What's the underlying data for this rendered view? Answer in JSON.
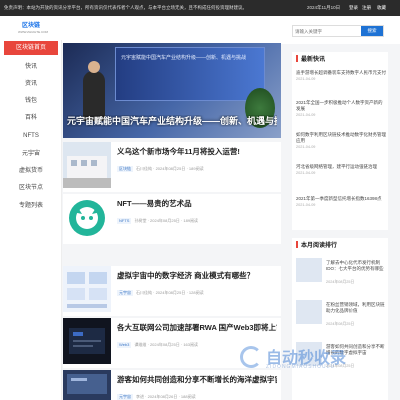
{
  "topbar": {
    "notice": "免责声明：本站为开放的资讯分享平台，所有资讯仅代表作者个人观点，与本平台立场无关，且不构成任何投资理财建议。",
    "date": "2024年11月10日",
    "login": "登录",
    "register": "注册",
    "favorite": "收藏"
  },
  "logo": {
    "name": "区块链",
    "sub": "WWW.ZHUIHTE.COM"
  },
  "sidebar": {
    "items": [
      {
        "label": "区块链首页",
        "active": true
      },
      {
        "label": "快讯"
      },
      {
        "label": "资讯"
      },
      {
        "label": "钱包"
      },
      {
        "label": "百科"
      },
      {
        "label": "NFTS"
      },
      {
        "label": "元宇宙"
      },
      {
        "label": "虚拟货币"
      },
      {
        "label": "区块节点"
      },
      {
        "label": "专题列表"
      }
    ]
  },
  "hero": {
    "screen_text": "元宇宙赋能中国汽车产业结构升级——创新、机遇与挑战",
    "caption": "元宇宙赋能中国汽车产业结构升级——创新、机遇与挑战”主题论"
  },
  "articles": [
    {
      "title": "义乌这个新市场今年11月将投入运营!",
      "tag": "区块链",
      "author": "石川佳纯",
      "date": "2024年08月25日",
      "views": "189阅读"
    },
    {
      "title": "NFT——易贵的艺术品",
      "tag": "NFTS",
      "author": "孙树堂",
      "date": "2024年08月25日",
      "views": "189阅读"
    },
    {
      "title": "虚拟宇宙中的数字经济 商业模式有哪些？",
      "tag": "元宇宙",
      "author": "石川佳纯",
      "date": "2024年08月25日",
      "views": "128阅读"
    },
    {
      "title": "各大互联网公司加速部署RWA 国产Web3即将上市",
      "tag": "Web3",
      "author": "谭维维",
      "date": "2024年08月25日",
      "views": "163阅读"
    },
    {
      "title": "游客如何共同创造和分享不断增长的海洋虚拟宇宙？",
      "tag": "元宇宙",
      "author": "李进",
      "date": "2024年08月26日",
      "views": "188阅读"
    }
  ],
  "search": {
    "placeholder": "请输入关键字",
    "button": "搜索"
  },
  "latest": {
    "title": "最新快讯",
    "items": [
      {
        "text": "迪手游增长超调番装车支持数字人民币元支付",
        "date": "2021-04-09"
      },
      {
        "text": "2021年全国一步积极推动个人数字资产新的发展",
        "date": "2021-04-09"
      },
      {
        "text": "如何数字利用区块链技术推动数字化财务管理应用",
        "date": "2021-04-09"
      },
      {
        "text": "河北省级网络管理，建平行运动强链治理",
        "date": "2021-04-09"
      },
      {
        "text": "2021年第一季度新型信托增长指数16398点",
        "date": "2021-04-09"
      }
    ]
  },
  "ranking": {
    "title": "本月阅读排行",
    "items": [
      {
        "text": "了解去中心化代币发行机制IDO：七大平台的优势有哪些",
        "date": "2024年08月25日"
      },
      {
        "text": "在粉丝营销领域，利用区块链助力化品牌价值",
        "date": "2024年08月25日"
      },
      {
        "text": "游客如何共同创造和分享不断增长的数字虚拟宇宙",
        "date": "2024年08月25日"
      }
    ]
  },
  "watermark": {
    "text": "自动秒收录",
    "sub": "ZIDONGMIAOSHOULU"
  },
  "colors": {
    "accent": "#e8463c",
    "blue": "#1e72d4",
    "topbar": "#2b2b2b"
  }
}
